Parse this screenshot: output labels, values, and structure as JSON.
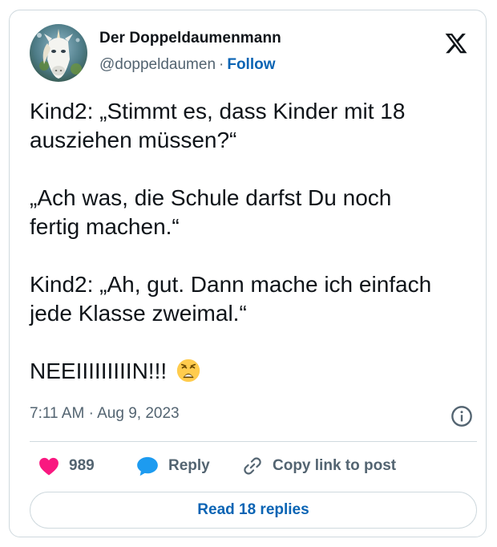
{
  "author": {
    "display_name": "Der Doppeldaumenmann",
    "handle": "@doppeldaumen",
    "separator": "·",
    "follow_label": "Follow",
    "avatar_icon": "unicorn-avatar"
  },
  "brand": {
    "logo_icon": "x-logo-icon"
  },
  "tweet": {
    "paragraphs": [
      [
        "Kind2: „Stimmt es, dass Kinder mit 18",
        "ausziehen müssen?“"
      ],
      [
        "„Ach was, die Schule darfst Du noch",
        "fertig machen.“"
      ],
      [
        "Kind2: „Ah, gut. Dann mache ich einfach",
        "jede Klasse zweimal.“"
      ],
      [
        "NEEIIIIIIIIIN!!!"
      ]
    ],
    "emoji": "weary-face-emoji",
    "timestamp": "7:11 AM · Aug 9, 2023"
  },
  "actions": {
    "like_count": "989",
    "reply_label": "Reply",
    "copy_label": "Copy link to post",
    "read_replies_label": "Read 18 replies"
  },
  "colors": {
    "follow_link": "#0a64b4",
    "like_heart": "#f91880",
    "reply_bubble": "#1d9bf0",
    "secondary_text": "#536471",
    "border": "#cfd9de"
  }
}
